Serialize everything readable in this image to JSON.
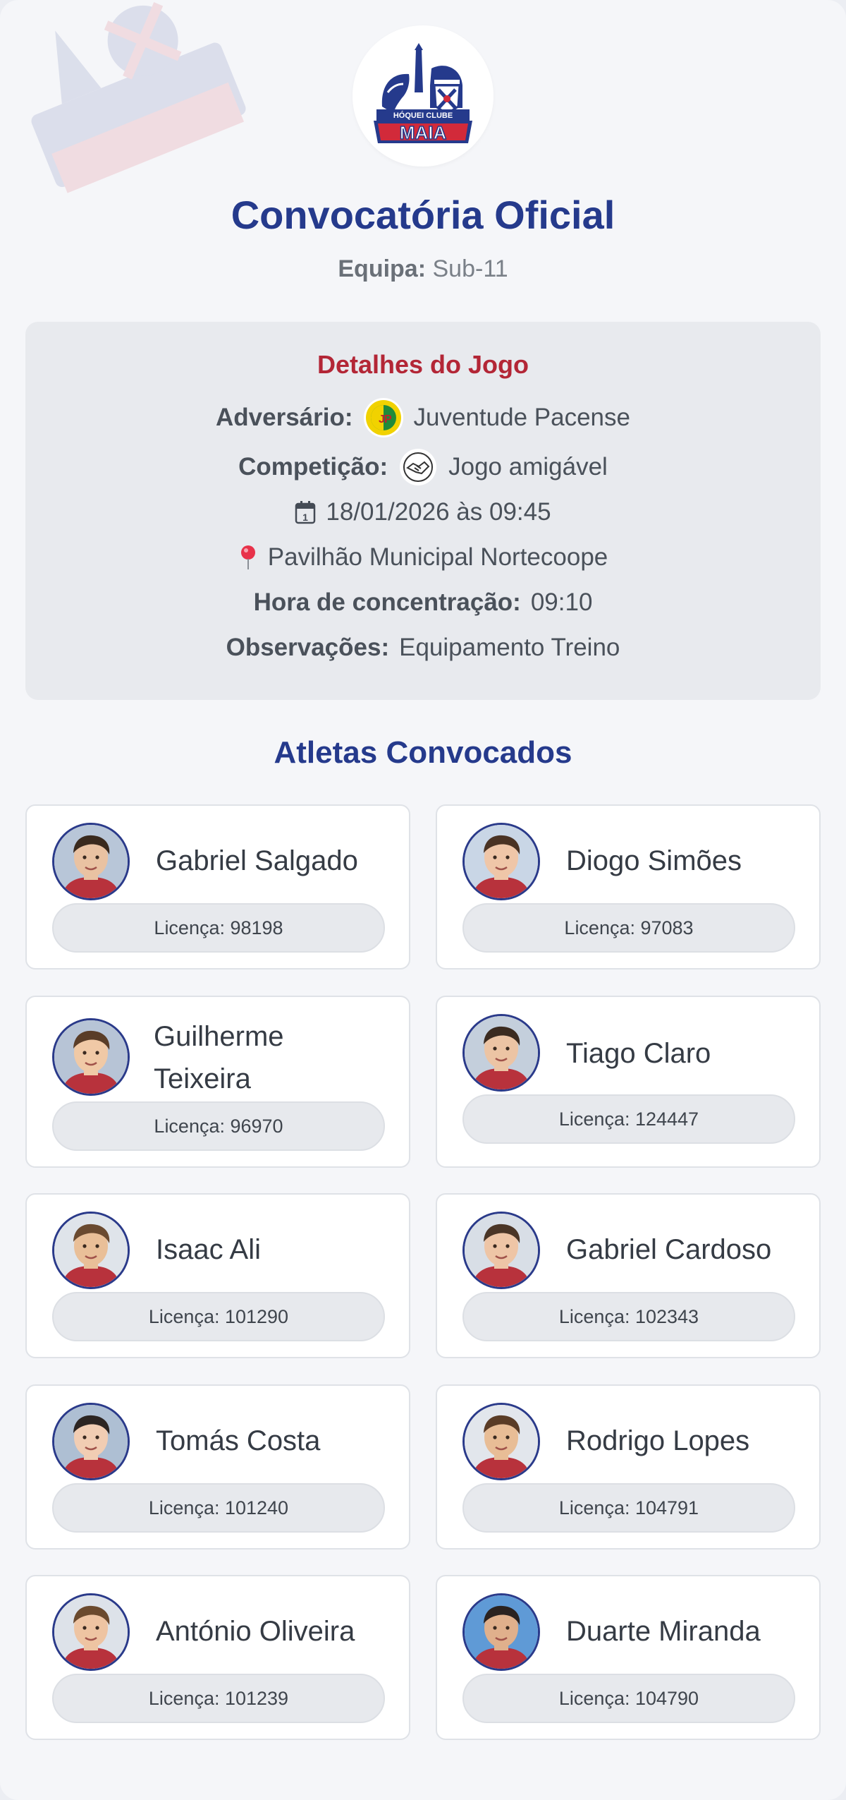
{
  "club": {
    "logo_text_top": "HÓQUEI CLUBE",
    "logo_text_main": "MAIA",
    "colors": {
      "navy": "#253a8c",
      "red": "#d22a3a"
    }
  },
  "header": {
    "title": "Convocatória Oficial",
    "team_label": "Equipa:",
    "team_value": "Sub-11"
  },
  "details": {
    "heading": "Detalhes do Jogo",
    "opponent_label": "Adversário:",
    "opponent_icon": "opponent-club-crest-icon",
    "opponent_value": "Juventude Pacense",
    "competition_label": "Competição:",
    "competition_icon": "handshake-icon",
    "competition_value": "Jogo amigável",
    "date_icon": "calendar-icon",
    "datetime": "18/01/2026 às 09:45",
    "location_icon": "pin-icon",
    "location": "Pavilhão Municipal Nortecoope",
    "meeting_label": "Hora de concentração:",
    "meeting_value": "09:10",
    "notes_label": "Observações:",
    "notes_value": "Equipamento Treino"
  },
  "athletes_title": "Atletas Convocados",
  "athletes": [
    {
      "name": "Gabriel Salgado",
      "license": "Licença: 98198",
      "skin": "#e9c2a2",
      "hair": "#3a2a1e",
      "bg": "#b8c6d8"
    },
    {
      "name": "Diogo Simões",
      "license": "Licença: 97083",
      "skin": "#efc6a8",
      "hair": "#4a3324",
      "bg": "#c9d6e6"
    },
    {
      "name": "Guilherme Teixeira",
      "license": "Licença: 96970",
      "skin": "#f0c9a6",
      "hair": "#5a3d28",
      "bg": "#b7c4d6"
    },
    {
      "name": "Tiago Claro",
      "license": "Licença: 124447",
      "skin": "#ecc4a4",
      "hair": "#3b2b20",
      "bg": "#c4cfdc"
    },
    {
      "name": "Isaac Ali",
      "license": "Licença: 101290",
      "skin": "#e9bf98",
      "hair": "#6a4a30",
      "bg": "#dfe4ea"
    },
    {
      "name": "Gabriel Cardoso",
      "license": "Licença: 102343",
      "skin": "#eec5a6",
      "hair": "#4a3526",
      "bg": "#d8dee6"
    },
    {
      "name": "Tomás Costa",
      "license": "Licença: 101240",
      "skin": "#f1cdb3",
      "hair": "#2c2522",
      "bg": "#aebfd3"
    },
    {
      "name": "Rodrigo Lopes",
      "license": "Licença: 104791",
      "skin": "#e8bd96",
      "hair": "#5a3c26",
      "bg": "#e2e6ec"
    },
    {
      "name": "António Oliveira",
      "license": "Licença: 101239",
      "skin": "#eec4a2",
      "hair": "#6b4a2e",
      "bg": "#dde2e9"
    },
    {
      "name": "Duarte Miranda",
      "license": "Licença: 104790",
      "skin": "#e0b08c",
      "hair": "#2a2220",
      "bg": "#5f9ad6"
    }
  ]
}
